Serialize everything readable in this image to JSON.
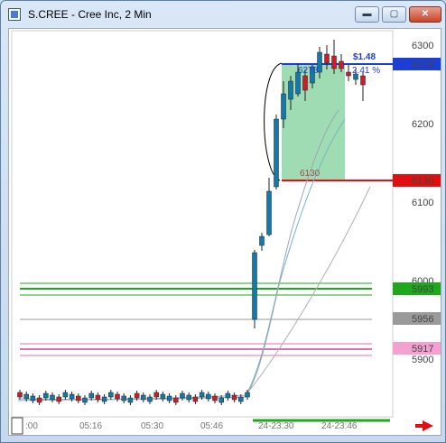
{
  "window": {
    "title": "S.CREE - Cree Inc, 2 Min",
    "min_glyph": "▬",
    "max_glyph": "▢",
    "close_glyph": "✕"
  },
  "price_axis": {
    "ticks": [
      "6300",
      "6200",
      "6100",
      "6000",
      "5900"
    ]
  },
  "price_labels": [
    {
      "text": "6278",
      "bg": "#1b3fd6",
      "fg": "#ffffff"
    },
    {
      "text": "6130",
      "bg": "#e01010",
      "fg": "#ffffff"
    },
    {
      "text": "5993",
      "bg": "#1ea81e",
      "fg": "#ffffff"
    },
    {
      "text": "5956",
      "bg": "#9a9a9a",
      "fg": "#ffffff"
    },
    {
      "text": "5917",
      "bg": "#f4a0d0",
      "fg": "#000000"
    }
  ],
  "time_axis": {
    "ticks": [
      ":00",
      "05:16",
      "05:30",
      "05:46",
      "24-23:30",
      "24-23:46"
    ]
  },
  "annotations": {
    "gain_amount": "$1.48",
    "gain_pct": "2.41 %",
    "entry_price": "6278",
    "stop_price": "6130"
  },
  "icons": {
    "scroll_right": "scroll-right-arrow-icon"
  },
  "colors": {
    "up": "#1478a8",
    "down": "#c8202a",
    "ma1": "#7ab0c8",
    "ma2": "#b0b0b0"
  }
}
